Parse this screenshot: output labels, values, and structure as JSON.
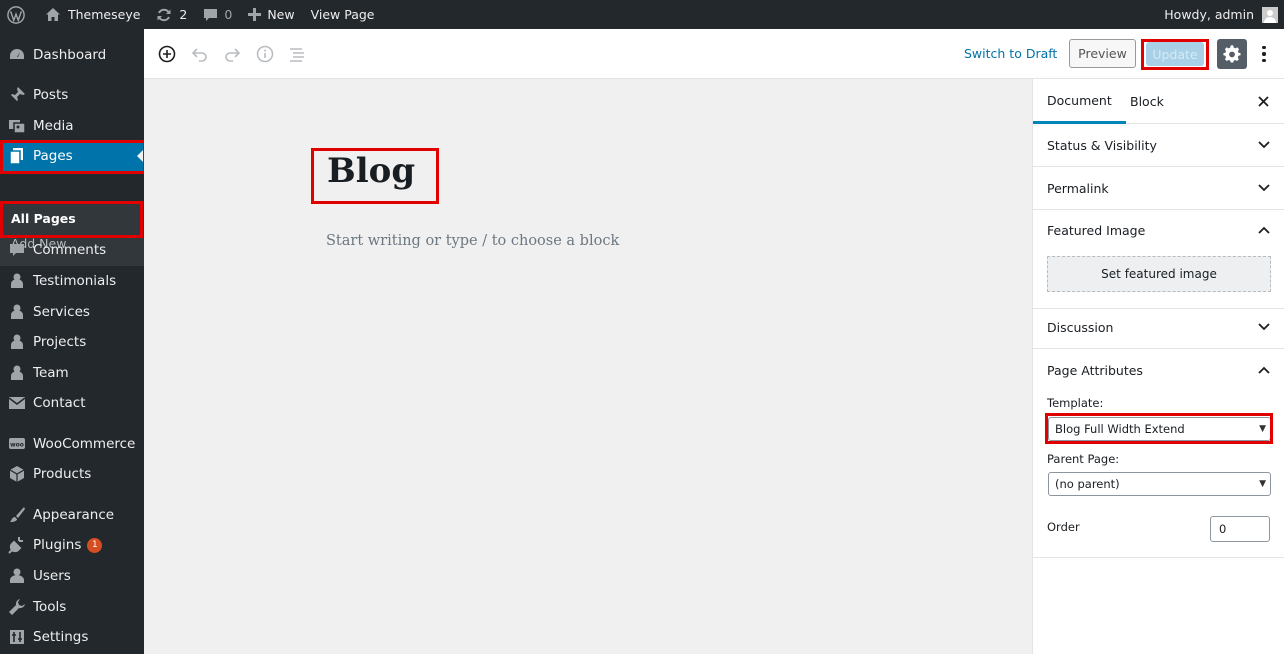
{
  "adminbar": {
    "site_name": "Themeseye",
    "updates_count": "2",
    "comments_count": "0",
    "new_label": "New",
    "view_page_label": "View Page",
    "greeting": "Howdy, admin"
  },
  "sidebar": {
    "items": [
      {
        "label": "Dashboard",
        "icon": "dashboard-icon"
      },
      {
        "label": "Posts",
        "icon": "pin-icon"
      },
      {
        "label": "Media",
        "icon": "media-icon"
      },
      {
        "label": "Pages",
        "icon": "pages-icon"
      },
      {
        "label": "Comments",
        "icon": "comment-icon"
      },
      {
        "label": "Testimonials",
        "icon": "person-icon"
      },
      {
        "label": "Services",
        "icon": "person-icon"
      },
      {
        "label": "Projects",
        "icon": "person-icon"
      },
      {
        "label": "Team",
        "icon": "person-icon"
      },
      {
        "label": "Contact",
        "icon": "mail-icon"
      },
      {
        "label": "WooCommerce",
        "icon": "woo-icon"
      },
      {
        "label": "Products",
        "icon": "box-icon"
      },
      {
        "label": "Appearance",
        "icon": "brush-icon"
      },
      {
        "label": "Plugins",
        "icon": "plugin-icon",
        "badge": "1"
      },
      {
        "label": "Users",
        "icon": "user-icon"
      },
      {
        "label": "Tools",
        "icon": "wrench-icon"
      },
      {
        "label": "Settings",
        "icon": "settings-icon"
      }
    ],
    "submenu": [
      {
        "label": "All Pages"
      },
      {
        "label": "Add New"
      }
    ]
  },
  "toolbar": {
    "switch_to_draft": "Switch to Draft",
    "preview": "Preview",
    "update": "Update"
  },
  "editor": {
    "title": "Blog",
    "placeholder": "Start writing or type / to choose a block"
  },
  "panel": {
    "tabs": [
      "Document",
      "Block"
    ],
    "sections": {
      "status": "Status & Visibility",
      "permalink": "Permalink",
      "featured_image": "Featured Image",
      "set_featured": "Set featured image",
      "discussion": "Discussion",
      "page_attributes": "Page Attributes"
    },
    "template_label": "Template:",
    "template_value": "Blog Full Width Extend",
    "parent_label": "Parent Page:",
    "parent_value": "(no parent)",
    "order_label": "Order",
    "order_value": "0"
  },
  "colors": {
    "admin_dark": "#23282d",
    "active_blue": "#0073aa",
    "highlight_red": "#e00000"
  }
}
